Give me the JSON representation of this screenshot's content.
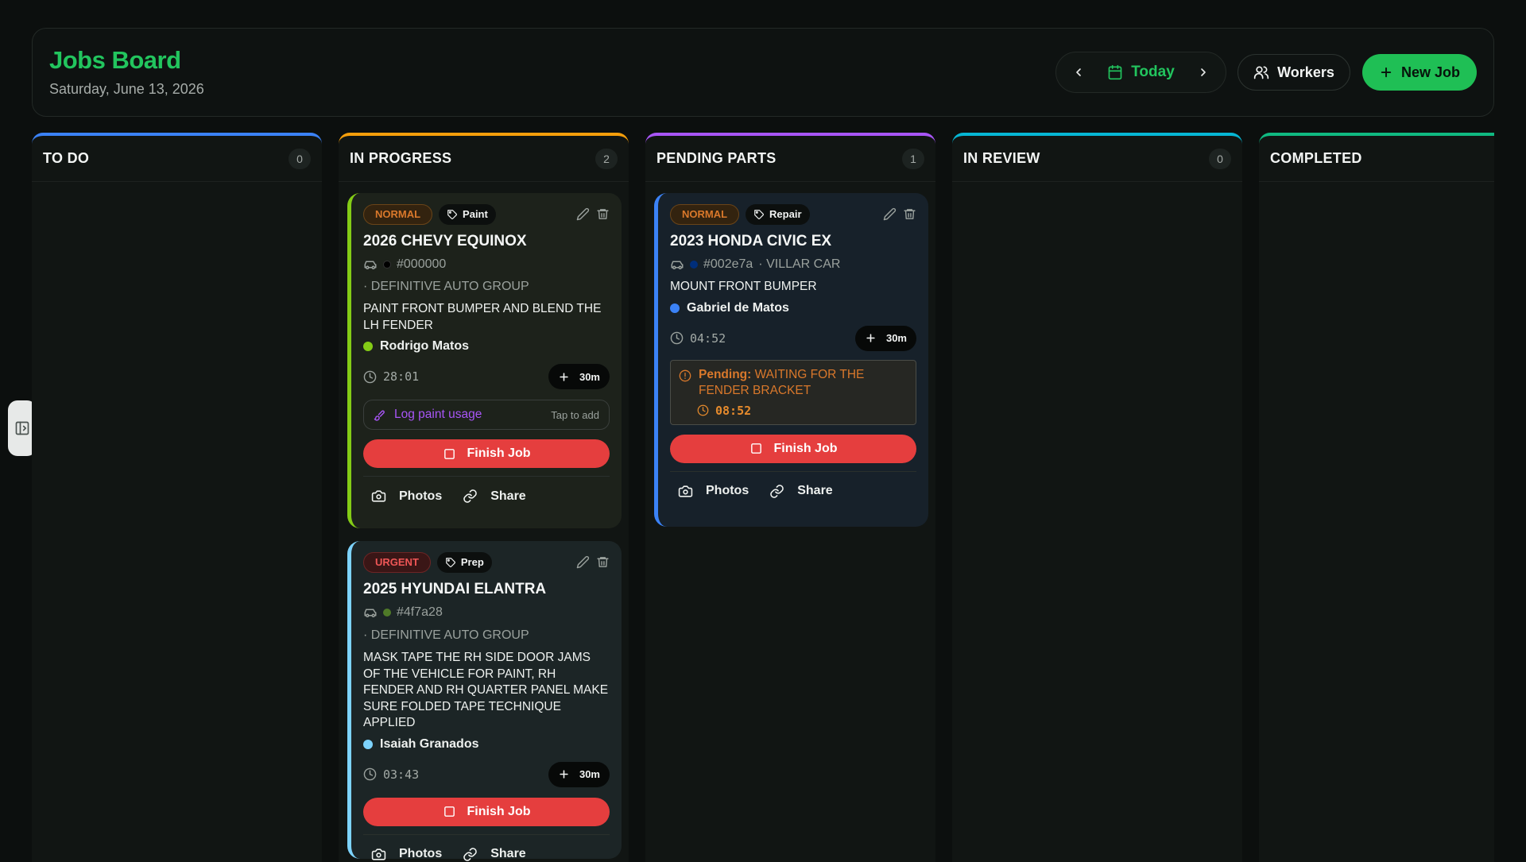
{
  "header": {
    "title": "Jobs Board",
    "date": "Saturday, June 13, 2026",
    "today_label": "Today",
    "workers_label": "Workers",
    "new_job_label": "New Job"
  },
  "colors": {
    "accent_green": "#22c55e",
    "todo": "#3b82f6",
    "in_progress": "#f59e0b",
    "pending_parts": "#a855f7",
    "in_review": "#06b6d4",
    "completed": "#10b981",
    "finish_red": "#e53e3e"
  },
  "columns": [
    {
      "title": "TO DO",
      "count": "0"
    },
    {
      "title": "IN PROGRESS",
      "count": "2"
    },
    {
      "title": "PENDING PARTS",
      "count": "1"
    },
    {
      "title": "IN REVIEW",
      "count": "0"
    },
    {
      "title": "COMPLETED",
      "count": ""
    }
  ],
  "cards": {
    "chevy": {
      "priority": "NORMAL",
      "tag": "Paint",
      "vehicle": "2026 CHEVY EQUINOX",
      "color_code": "#000000",
      "customer": "· DEFINITIVE AUTO GROUP",
      "description": "PAINT FRONT BUMPER AND BLEND THE LH FENDER",
      "worker": "Rodrigo Matos",
      "timer": "28:01",
      "add_label": "30m",
      "paint_log_label": "Log paint usage",
      "paint_log_hint": "Tap to add",
      "finish_label": "Finish Job",
      "photos_label": "Photos",
      "share_label": "Share"
    },
    "hyundai": {
      "priority": "URGENT",
      "tag": "Prep",
      "vehicle": "2025 HYUNDAI ELANTRA",
      "color_code": "#4f7a28",
      "customer": "· DEFINITIVE AUTO GROUP",
      "description": "MASK TAPE THE RH SIDE DOOR JAMS OF THE VEHICLE FOR PAINT, RH FENDER AND RH QUARTER PANEL MAKE SURE FOLDED TAPE TECHNIQUE APPLIED",
      "worker": "Isaiah Granados",
      "timer": "03:43",
      "add_label": "30m",
      "finish_label": "Finish Job",
      "photos_label": "Photos",
      "share_label": "Share"
    },
    "honda": {
      "priority": "NORMAL",
      "tag": "Repair",
      "vehicle": "2023 HONDA CIVIC EX",
      "color_code": "#002e7a",
      "customer": "· VILLAR CAR",
      "description": "MOUNT FRONT BUMPER",
      "worker": "Gabriel de Matos",
      "timer": "04:52",
      "add_label": "30m",
      "pending_label": "Pending:",
      "pending_text": "WAITING FOR THE FENDER BRACKET",
      "pending_timer": "08:52",
      "finish_label": "Finish Job",
      "photos_label": "Photos",
      "share_label": "Share"
    }
  },
  "icons": [
    "chevron-left-icon",
    "chevron-right-icon",
    "calendar-icon",
    "users-icon",
    "plus-icon",
    "sidebar-toggle-icon",
    "tag-icon",
    "pencil-icon",
    "trash-icon",
    "car-icon",
    "clock-icon",
    "brush-icon",
    "square-icon",
    "camera-icon",
    "link-icon",
    "alert-circle-icon"
  ]
}
